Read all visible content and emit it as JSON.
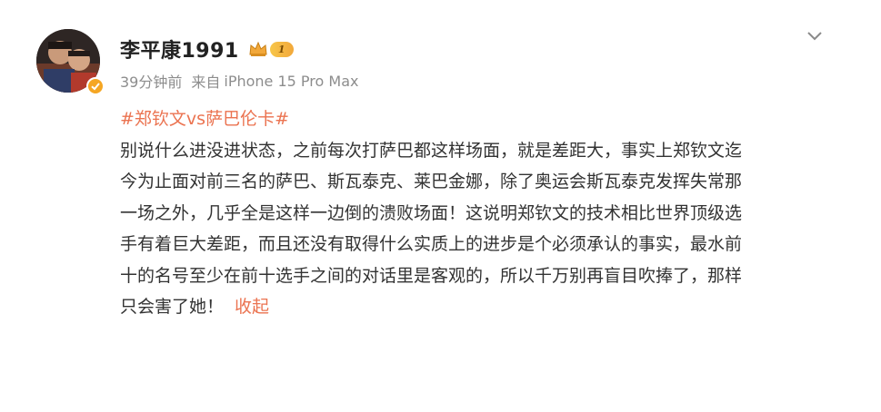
{
  "post": {
    "username": "李平康1991",
    "vip_level": "1",
    "time": "39分钟前",
    "source_prefix": "来自",
    "device": "iPhone 15 Pro Max",
    "hashtag": "#郑钦文vs萨巴伦卡#",
    "lines": [
      "别说什么进没进状态，之前每次打萨巴都这样场面，就是差距大，事实上郑钦文迄",
      "今为止面对前三名的萨巴、斯瓦泰克、莱巴金娜，除了奥运会斯瓦泰克发挥失常那",
      "一场之外，几乎全是这样一边倒的溃败场面！这说明郑钦文的技术相比世界顶级选",
      "手有着巨大差距，而且还没有取得什么实质上的进步是个必须承认的事实，最水前",
      "十的名号至少在前十选手之间的对话里是客观的，所以千万别再盲目吹捧了，那样",
      "只会害了她！"
    ],
    "collapse_label": "收起"
  },
  "icons": {
    "avatar": "user-avatar-photo",
    "verify": "verified-badge-icon",
    "vip": "crown-icon",
    "menu": "chevron-down-icon"
  },
  "colors": {
    "link": "#eb7350",
    "meta": "#8d8d8d",
    "text": "#333333",
    "username": "#222222",
    "vip_gold": "#f2a83a"
  }
}
